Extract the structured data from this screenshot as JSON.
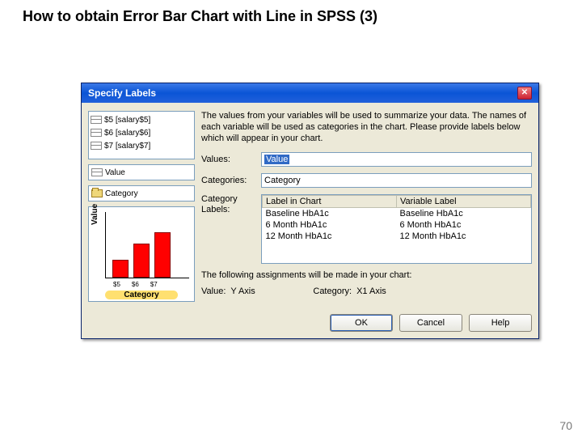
{
  "slide": {
    "title": "How to obtain Error Bar Chart  with Line in SPSS (3)",
    "page_number": "70"
  },
  "dialog": {
    "title": "Specify Labels",
    "close_glyph": "✕",
    "description": "The values from your variables will be used to summarize your data. The names of each variable will be used as categories in the chart. Please provide labels below which will appear in your chart.",
    "list_items": [
      "$5 [salary$5]",
      "$6 [salary$6]",
      "$7 [salary$7]"
    ],
    "drop_value": "Value",
    "drop_category": "Category",
    "values_label": "Values:",
    "values_value": "Value",
    "categories_label": "Categories:",
    "categories_value": "Category",
    "catlabels_label": "Category Labels:",
    "table": {
      "col1": "Label in Chart",
      "col2": "Variable Label",
      "rows": [
        {
          "c1": "Baseline HbA1c",
          "c2": "Baseline HbA1c"
        },
        {
          "c1": "6 Month HbA1c",
          "c2": "6 Month HbA1c"
        },
        {
          "c1": "12 Month HbA1c",
          "c2": "12 Month HbA1c"
        }
      ]
    },
    "assign_intro": "The following assignments will be made in your chart:",
    "assign_value_lbl": "Value:",
    "assign_value_val": "Y Axis",
    "assign_cat_lbl": "Category:",
    "assign_cat_val": "X1 Axis",
    "buttons": {
      "ok": "OK",
      "cancel": "Cancel",
      "help": "Help"
    },
    "mini": {
      "ylabel": "Value",
      "xlabel": "Category",
      "t1": "$5",
      "t2": "$6",
      "t3": "$7"
    }
  },
  "chart_data": {
    "type": "bar",
    "title": "",
    "xlabel": "Category",
    "ylabel": "Value",
    "categories": [
      "$5",
      "$6",
      "$7"
    ],
    "values": [
      22,
      42,
      56
    ],
    "ylim": [
      0,
      60
    ],
    "note": "preview thumbnail in SPSS dialog; values are approximate relative heights"
  }
}
